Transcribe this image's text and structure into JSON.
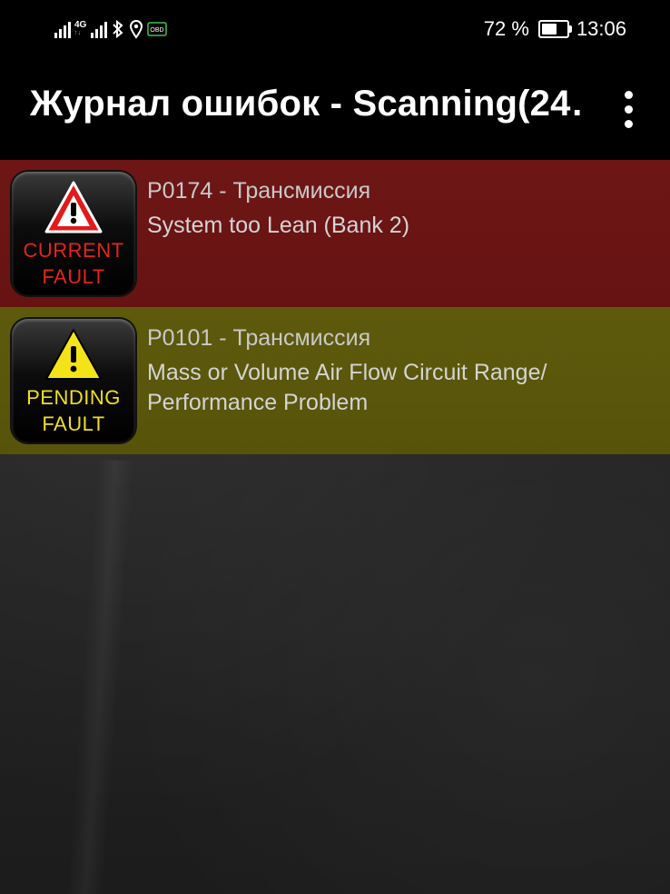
{
  "status_bar": {
    "network_type": "4G",
    "battery_percent": "72 %",
    "battery_level": 0.72,
    "time": "13:06",
    "obd_icon_text": "OBD",
    "icons": [
      "signal-icon",
      "signal-4g-icon",
      "bluetooth-icon",
      "location-icon",
      "obd-icon",
      "battery-icon"
    ]
  },
  "app_bar": {
    "title": "Журнал ошибок - Scanning(24…",
    "menu_icon": "more-vert-icon"
  },
  "faults": [
    {
      "status": "current",
      "badge_line1": "CURRENT",
      "badge_line2": "FAULT",
      "code": "P0174 - Трансмиссия",
      "description": "System too Lean (Bank 2)",
      "row_color": "#6b1414",
      "badge_text_color": "#e52417",
      "warning_triangle_color": "#e21a1a"
    },
    {
      "status": "pending",
      "badge_line1": "PENDING",
      "badge_line2": "FAULT",
      "code": "P0101 - Трансмиссия",
      "description": "Mass or Volume Air Flow Circuit Range/ Performance Problem",
      "row_color": "#5b570b",
      "badge_text_color": "#f0df1f",
      "warning_triangle_color": "#f5e31a"
    }
  ]
}
